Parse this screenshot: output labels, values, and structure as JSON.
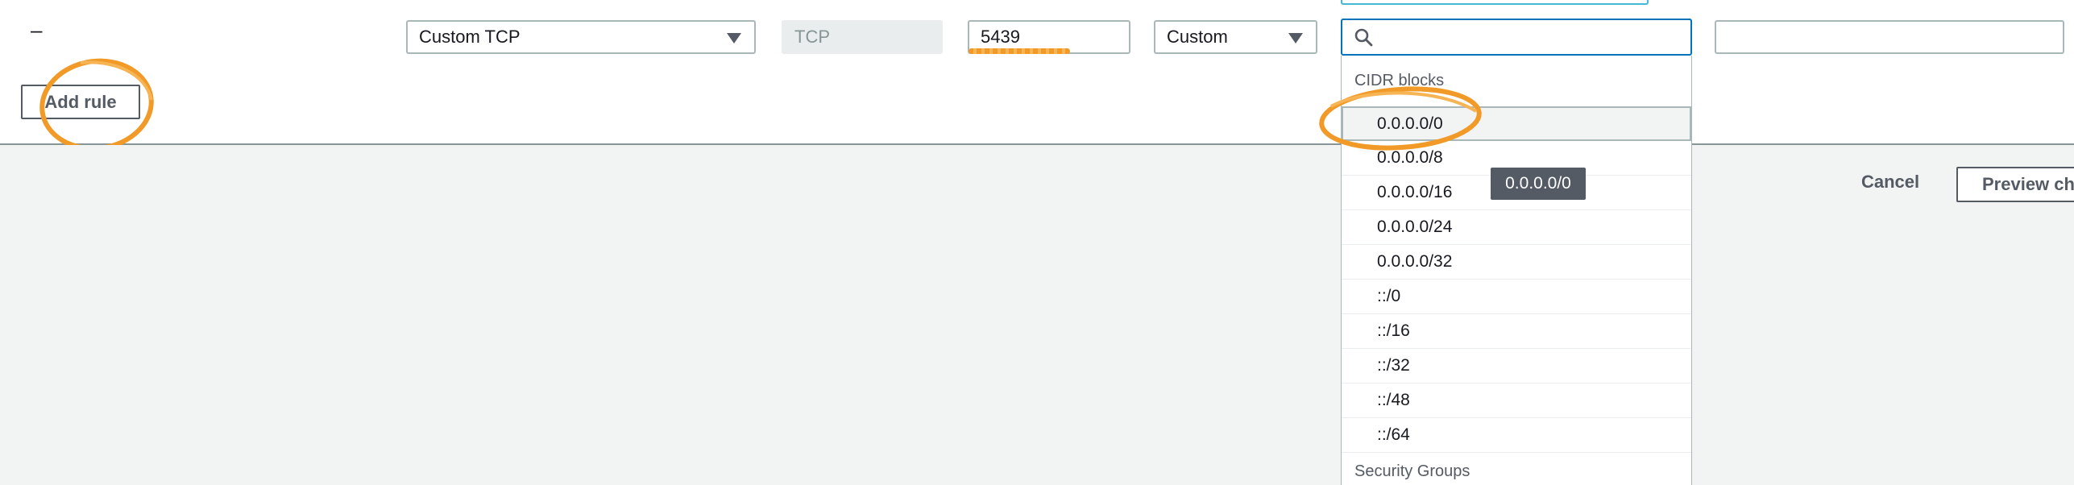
{
  "rule_row": {
    "remove_label": "–",
    "type_value": "Custom TCP",
    "protocol_value": "TCP",
    "port_range_value": "5439",
    "source_type_value": "Custom",
    "source_search_value": "",
    "description_value": ""
  },
  "add_rule_label": "Add rule",
  "source_dropdown": {
    "group_cidr_label": "CIDR blocks",
    "options": [
      "0.0.0.0/0",
      "0.0.0.0/8",
      "0.0.0.0/16",
      "0.0.0.0/24",
      "0.0.0.0/32",
      "::/0",
      "::/16",
      "::/32",
      "::/48",
      "::/64"
    ],
    "highlighted_option": "0.0.0.0/0",
    "group_sg_label": "Security Groups"
  },
  "tooltip_text": "0.0.0.0/0",
  "footer": {
    "cancel_label": "Cancel",
    "preview_label": "Preview changes"
  },
  "annotation_color": "#f19a28",
  "focus_color": "#0073bb",
  "icons": [
    "search-icon",
    "caret-down-icon"
  ]
}
